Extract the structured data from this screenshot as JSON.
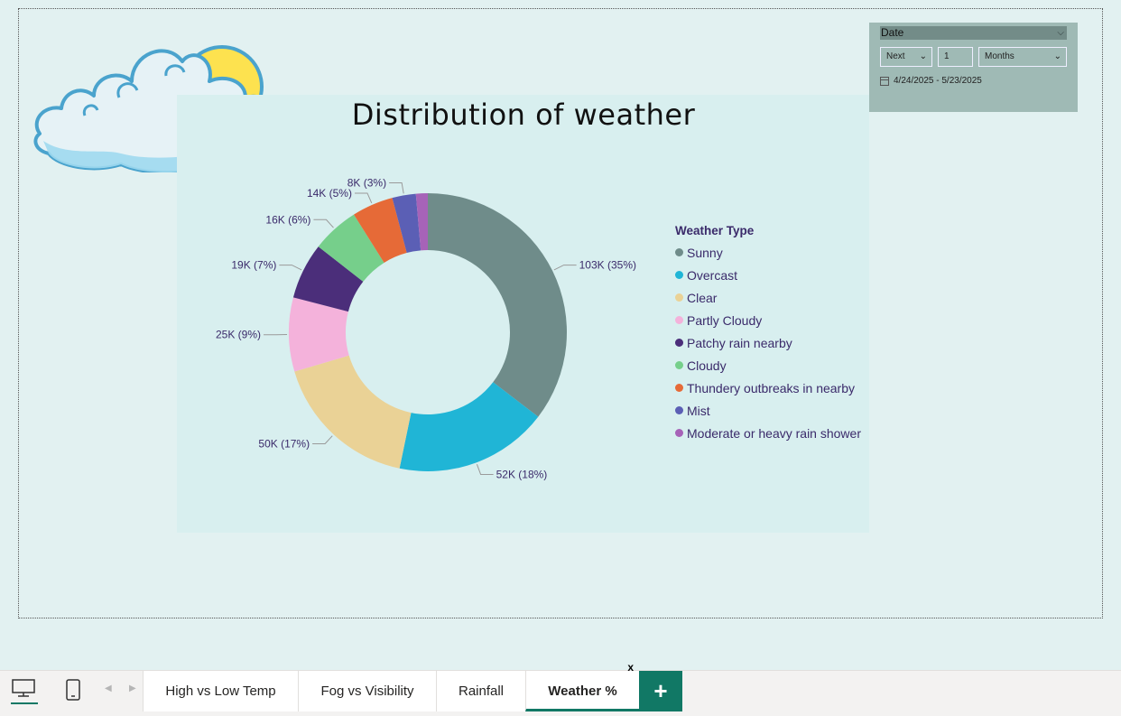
{
  "title": "Distribution of weather",
  "legend": {
    "title": "Weather Type",
    "items": [
      {
        "label": "Sunny",
        "color": "#6f8c8a"
      },
      {
        "label": "Overcast",
        "color": "#20b5d6"
      },
      {
        "label": "Clear",
        "color": "#ead296"
      },
      {
        "label": "Partly Cloudy",
        "color": "#f4b2db"
      },
      {
        "label": "Patchy rain nearby",
        "color": "#4b2e7a"
      },
      {
        "label": "Cloudy",
        "color": "#76cf8b"
      },
      {
        "label": "Thundery outbreaks in nearby",
        "color": "#e66a37"
      },
      {
        "label": "Mist",
        "color": "#5b5fb5"
      },
      {
        "label": "Moderate or heavy rain shower",
        "color": "#a663b8"
      }
    ]
  },
  "chart_data": {
    "type": "pie",
    "style": "donut",
    "title": "Distribution of weather",
    "legend_title": "Weather Type",
    "legend_position": "right",
    "categories": [
      "Sunny",
      "Overcast",
      "Clear",
      "Partly Cloudy",
      "Patchy rain nearby",
      "Cloudy",
      "Thundery outbreaks in nearby",
      "Mist",
      "Moderate or heavy rain shower"
    ],
    "values": [
      103,
      52,
      50,
      25,
      19,
      16,
      14,
      8,
      4
    ],
    "unit": "K",
    "labels": [
      "103K (35%)",
      "52K (18%)",
      "50K (17%)",
      "25K (9%)",
      "19K (7%)",
      "16K (6%)",
      "14K (5%)",
      "8K (3%)",
      ""
    ]
  },
  "slicer": {
    "header": "Date",
    "mode": "Next",
    "count": "1",
    "unit": "Months",
    "range": "4/24/2025 - 5/23/2025"
  },
  "tabs": [
    {
      "label": "High vs Low Temp"
    },
    {
      "label": "Fog vs Visibility"
    },
    {
      "label": "Rainfall"
    },
    {
      "label": "Weather %"
    }
  ],
  "add_tab": "+",
  "close_tab": "x",
  "icons": {
    "desktop": "desktop-icon",
    "phone": "phone-icon",
    "prev": "chevron-left-icon",
    "next": "chevron-right-icon",
    "calendar": "calendar-icon"
  }
}
